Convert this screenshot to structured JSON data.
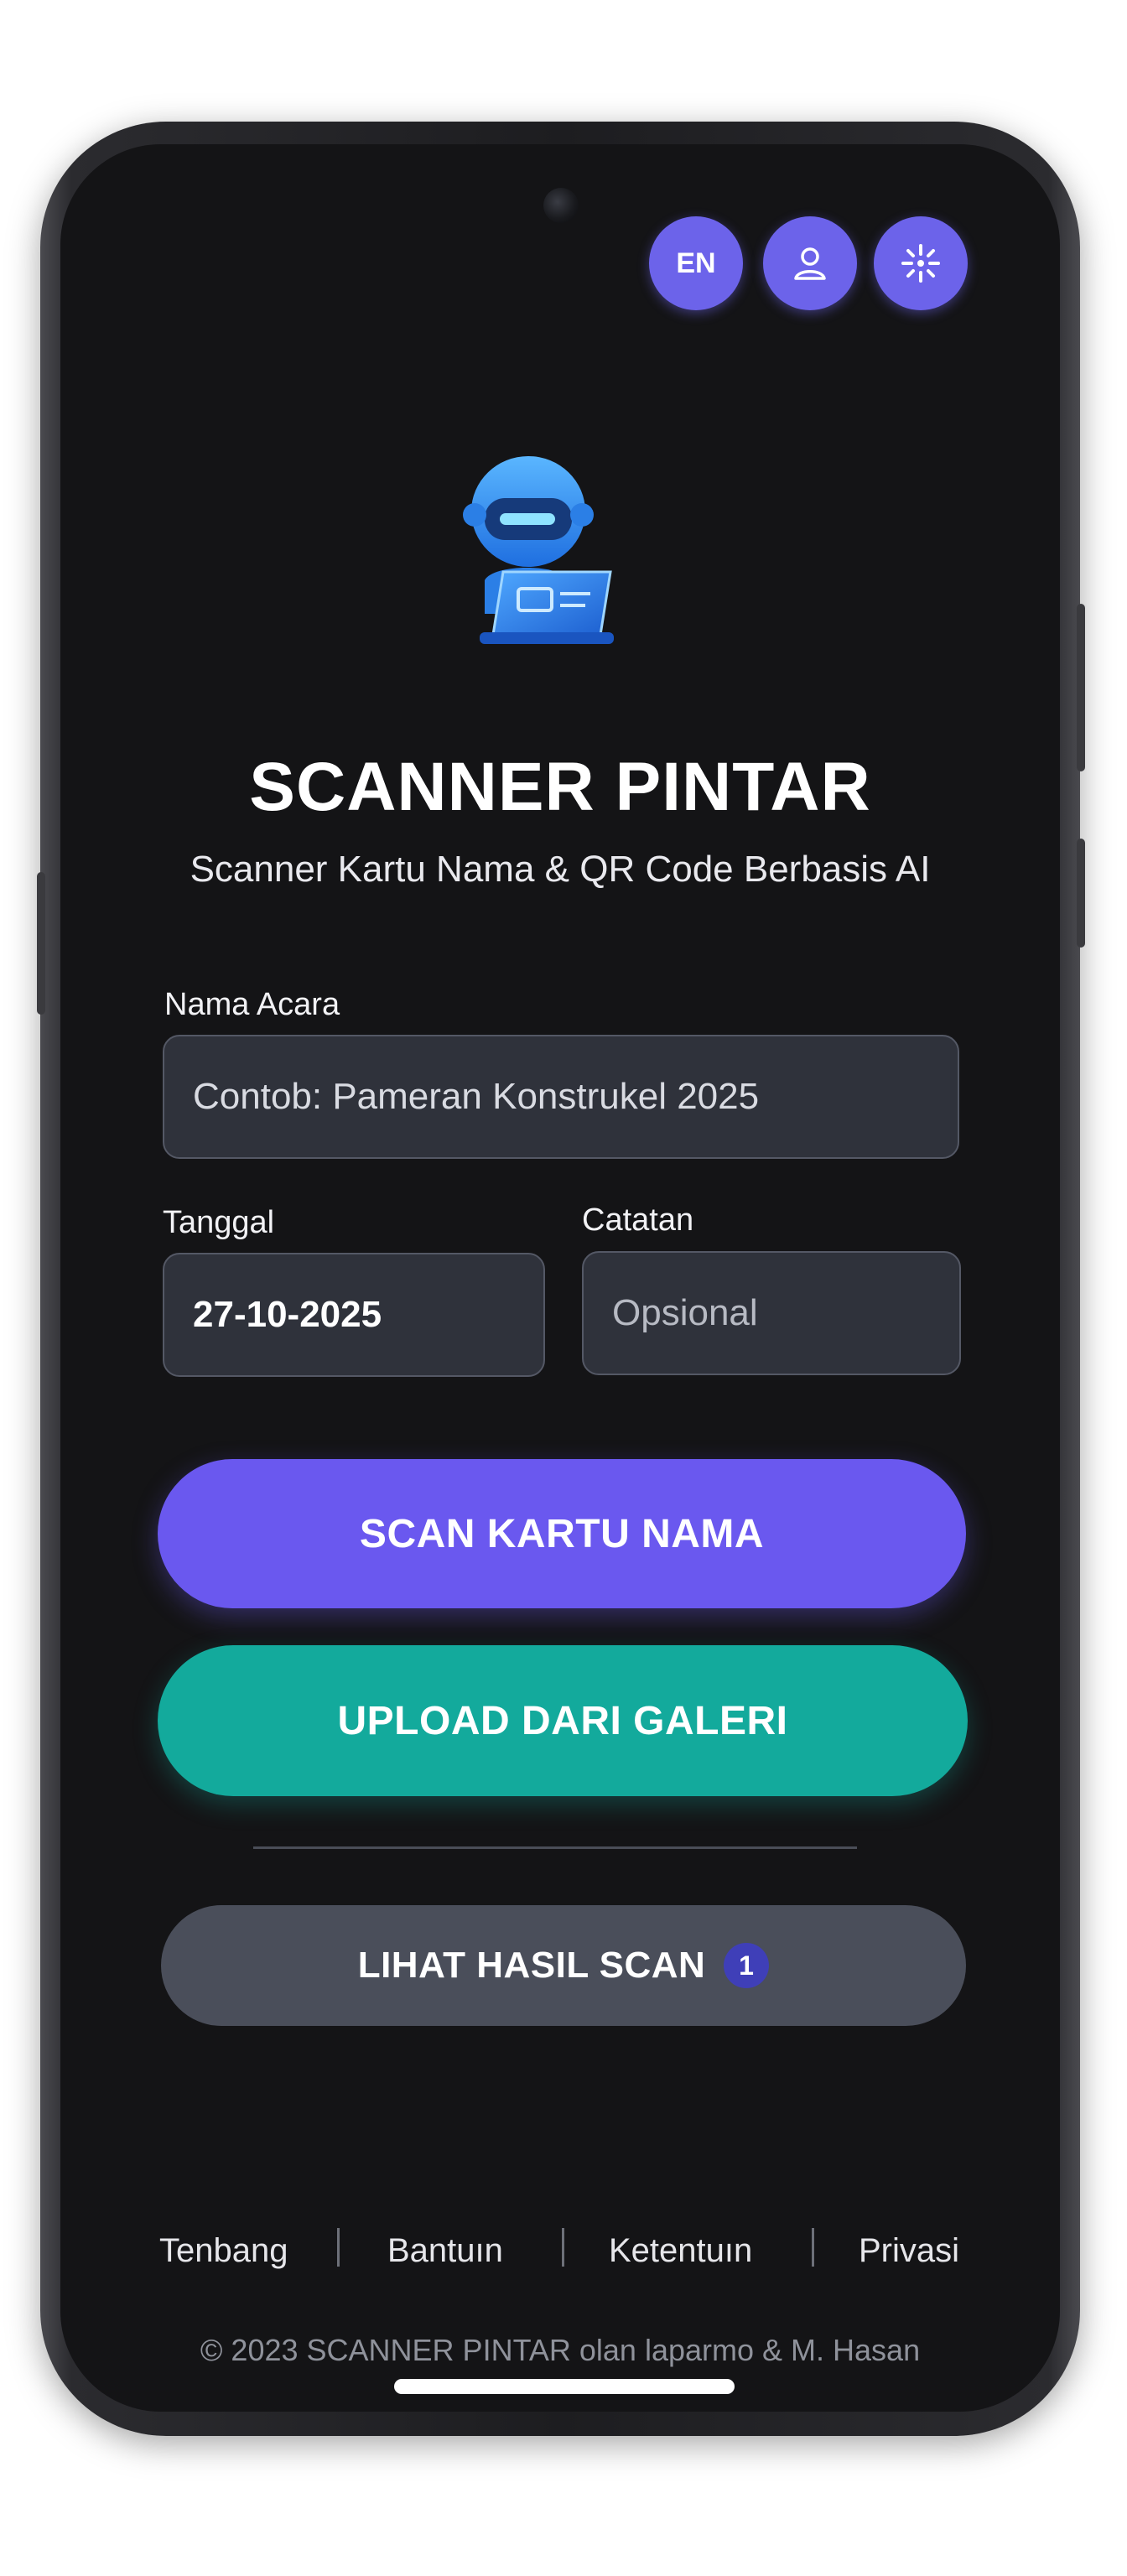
{
  "header": {
    "language_label": "EN",
    "profile_icon": "person-icon",
    "settings_icon": "sparkle-icon"
  },
  "app": {
    "logo_icon": "robot-scanner-icon",
    "title": "SCANNER PINTAR",
    "subtitle": "Scanner Kartu Nama & QR Code Berbasis AI"
  },
  "form": {
    "event_label": "Nama Acara",
    "event_placeholder": "Contob: Pameran Konstrukel 2025",
    "date_label": "Tanggal",
    "date_value": "27-10-2025",
    "note_label": "Catatan",
    "note_placeholder": "Opsional"
  },
  "actions": {
    "scan_label": "SCAN KARTU NAMA",
    "upload_label": "UPLOAD DARI GALERI",
    "results_label": "LIHAT HASIL SCAN",
    "results_count": "1"
  },
  "footer": {
    "links": [
      "Tenbang",
      "Bantuın",
      "Ketentuın",
      "Privasi"
    ],
    "copyright": "© 2023 SCANNER PINTAR olan laparmo & M. Hasan"
  },
  "colors": {
    "accent": "#6c63ea",
    "scan_button": "#6a58ef",
    "upload_button": "#13aa9c",
    "results_button": "#4a4e5a",
    "background": "#141416"
  }
}
